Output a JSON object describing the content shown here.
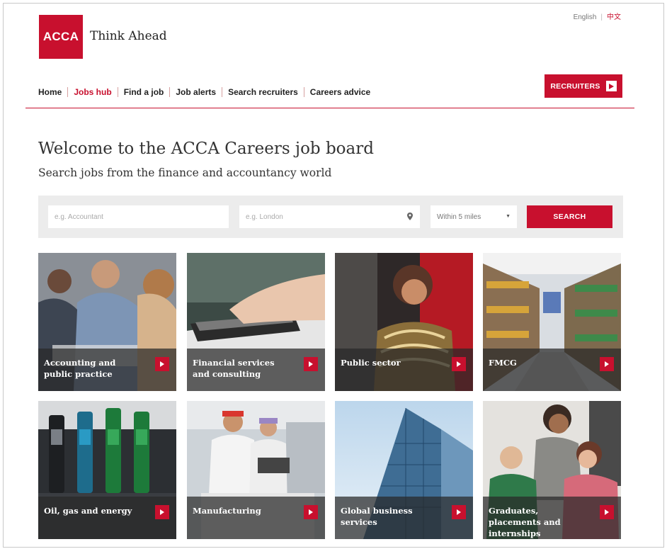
{
  "header": {
    "lang_english": "English",
    "lang_chinese": "中文",
    "logo_text": "ACCA",
    "tagline": "Think Ahead",
    "recruiters_label": "RECRUITERS"
  },
  "nav": {
    "items": [
      "Home",
      "Jobs hub",
      "Find a job",
      "Job alerts",
      "Search recruiters",
      "Careers advice"
    ],
    "active_index": 1
  },
  "hero": {
    "title": "Welcome to the ACCA Careers job board",
    "subtitle": "Search jobs from the finance and accountancy world"
  },
  "search": {
    "keyword_placeholder": "e.g. Accountant",
    "location_placeholder": "e.g. London",
    "radius_selected": "Within 5 miles",
    "button_label": "SEARCH"
  },
  "sectors": [
    {
      "label": "Accounting and public practice",
      "image": "people-at-desk"
    },
    {
      "label": "Financial services and consulting",
      "image": "calculator-hand"
    },
    {
      "label": "Public sector",
      "image": "smiling-woman"
    },
    {
      "label": "FMCG",
      "image": "supermarket-aisle"
    },
    {
      "label": "Oil, gas and energy",
      "image": "fuel-pumps"
    },
    {
      "label": "Manufacturing",
      "image": "lab-workers"
    },
    {
      "label": "Global business services",
      "image": "glass-tower"
    },
    {
      "label": "Graduates, placements and internships",
      "image": "students-laptop"
    }
  ],
  "colors": {
    "brand_red": "#c8102e",
    "panel_grey": "#ececec"
  }
}
